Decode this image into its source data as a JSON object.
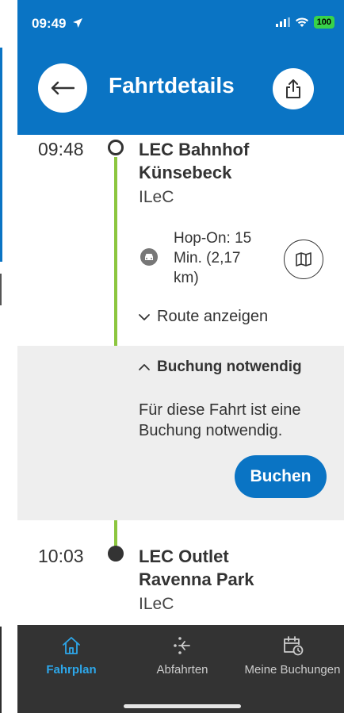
{
  "status_bar": {
    "time": "09:49",
    "battery": "100"
  },
  "header": {
    "title": "Fahrtdetails"
  },
  "trip": {
    "departure": {
      "time": "09:48",
      "name_line1": "LEC Bahnhof",
      "name_line2": "Künsebeck",
      "operator": "ILeC"
    },
    "hop_on": {
      "line1": "Hop-On: 15",
      "line2": "Min. (2,17",
      "line3": "km)"
    },
    "route_toggle": "Route anzeigen",
    "booking": {
      "title": "Buchung notwendig",
      "text_line1": "Für diese Fahrt ist eine",
      "text_line2": "Buchung notwendig.",
      "button": "Buchen"
    },
    "arrival": {
      "time": "10:03",
      "name_line1": "LEC Outlet",
      "name_line2": "Ravenna Park",
      "operator": "ILeC"
    }
  },
  "bottom_nav": [
    {
      "label": "Fahrplan",
      "icon": "home-icon",
      "active": true
    },
    {
      "label": "Abfahrten",
      "icon": "departures-icon",
      "active": false
    },
    {
      "label": "Meine Buchungen",
      "icon": "calendar-clock-icon",
      "active": false
    }
  ],
  "colors": {
    "primary": "#0a74c4",
    "route_line": "#8cc63f",
    "nav_bg": "#333333",
    "nav_active": "#2da7ea",
    "panel_bg": "#eeeeee"
  }
}
